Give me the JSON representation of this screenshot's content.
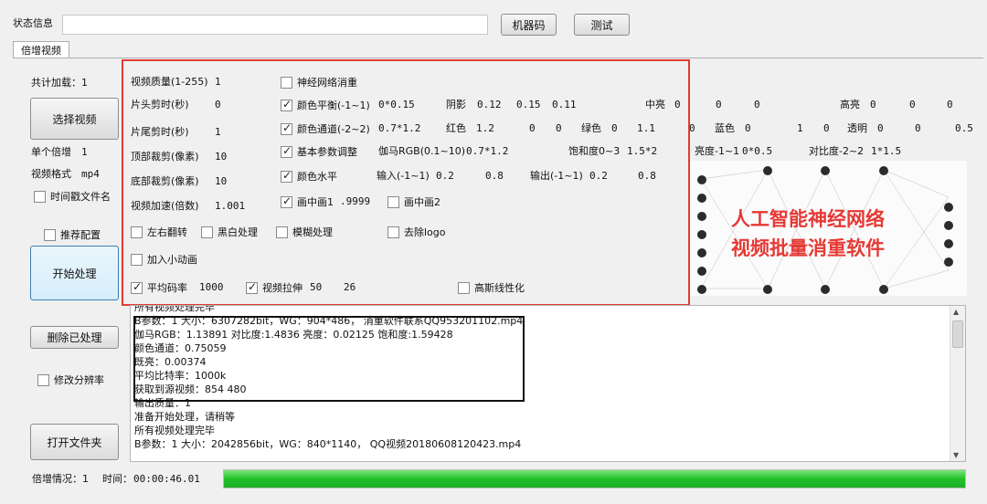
{
  "status": {
    "label": "状态信息",
    "value": "",
    "machine_code_btn": "机器码",
    "test_btn": "测试"
  },
  "tab": {
    "label": "倍增视频"
  },
  "left": {
    "total_load_label": "共计加载：1",
    "select_video_btn": "选择视频",
    "single_multiply_label": "单个倍增",
    "single_multiply_value": "1",
    "video_format_label": "视频格式",
    "video_format_value": "mp4",
    "timestamp_filename_label": "时间戳文件名",
    "recommended_label": "推荐配置",
    "start_btn": "开始处理",
    "delete_processed_btn": "删除已处理",
    "change_resolution_label": "修改分辨率",
    "open_folder_btn": "打开文件夹"
  },
  "params": {
    "quality_label": "视频质量(1-255)",
    "quality_value": "1",
    "head_cut_label": "片头剪时(秒)",
    "head_cut_value": "0",
    "tail_cut_label": "片尾剪时(秒)",
    "tail_cut_value": "1",
    "top_crop_label": "顶部裁剪(像素)",
    "top_crop_value": "10",
    "bottom_crop_label": "底部裁剪(像素)",
    "bottom_crop_value": "10",
    "speed_label": "视频加速(倍数)",
    "speed_value": "1.001",
    "nn_dedup_label": "神经网络消重",
    "color_balance_label": "颜色平衡(-1~1)",
    "color_balance_value": "0*0.15",
    "shadow_label": "阴影",
    "shadow_vals": [
      "0.12",
      "0.15",
      "0.11"
    ],
    "midtone_label": "中亮",
    "midtone_vals": [
      "0",
      "0",
      "0"
    ],
    "highlight_label": "高亮",
    "highlight_vals": [
      "0",
      "0",
      "0"
    ],
    "color_channel_label": "颜色通道(-2~2)",
    "color_channel_value": "0.7*1.2",
    "red_label": "红色",
    "red_vals": [
      "1.2",
      "0",
      "0"
    ],
    "green_label": "绿色",
    "green_vals": [
      "0",
      "1.1",
      "0"
    ],
    "blue_label": "蓝色",
    "blue_vals": [
      "0",
      "1",
      "0"
    ],
    "alpha_label": "透明",
    "alpha_vals": [
      "0",
      "0",
      "0.5"
    ],
    "basic_adjust_label": "基本参数调整",
    "gamma_label": "伽马RGB(0.1~10)",
    "gamma_value": "0.7*1.2",
    "saturation_label": "饱和度0~3",
    "saturation_value": "1.5*2",
    "brightness_label": "亮度-1~1",
    "brightness_value": "0*0.5",
    "contrast_label": "对比度-2~2",
    "contrast_value": "1*1.5",
    "color_level_label": "颜色水平",
    "input_label": "输入(-1~1)",
    "input_vals": [
      "0.2",
      "0.8"
    ],
    "output_label": "输出(-1~1)",
    "output_vals": [
      "0.2",
      "0.8"
    ],
    "pip1_label": "画中画1",
    "pip1_value": ".9999",
    "pip2_label": "画中画2",
    "flip_label": "左右翻转",
    "bw_label": "黑白处理",
    "blur_label": "模糊处理",
    "remove_logo_label": "去除logo",
    "add_anim_label": "加入小动画",
    "avg_bitrate_label": "平均码率",
    "avg_bitrate_value": "1000",
    "stretch_label": "视频拉伸",
    "stretch_vals": [
      "50",
      "26"
    ],
    "gauss_label": "高斯线性化"
  },
  "overlay": {
    "line1": "人工智能神经网络",
    "line2": "视频批量消重软件"
  },
  "log": {
    "lines": [
      "所有视频处理完毕",
      "B参数：1  大小：6307282bit，WG：904*486，  消重软件联系QQ953201102.mp4",
      "伽马RGB：1.13891 对比度:1.4836 亮度：0.02125 饱和度:1.59428",
      "颜色通道：0.75059",
      "既亮：0.00374",
      "平均比特率：1000k",
      "获取到源视频：854  480",
      "输出质量：1",
      "准备开始处理，请稍等",
      "所有视频处理完毕",
      "B参数：1  大小：2042856bit，WG：840*1140，  QQ视频20180608120423.mp4"
    ]
  },
  "footer": {
    "multiply_status": "倍增情况：1",
    "time_label": "时间：",
    "time_value": "00:00:46.01",
    "progress": 1.0
  },
  "colors": {
    "accent_red": "#e53935",
    "progress_green": "#22c12a"
  }
}
